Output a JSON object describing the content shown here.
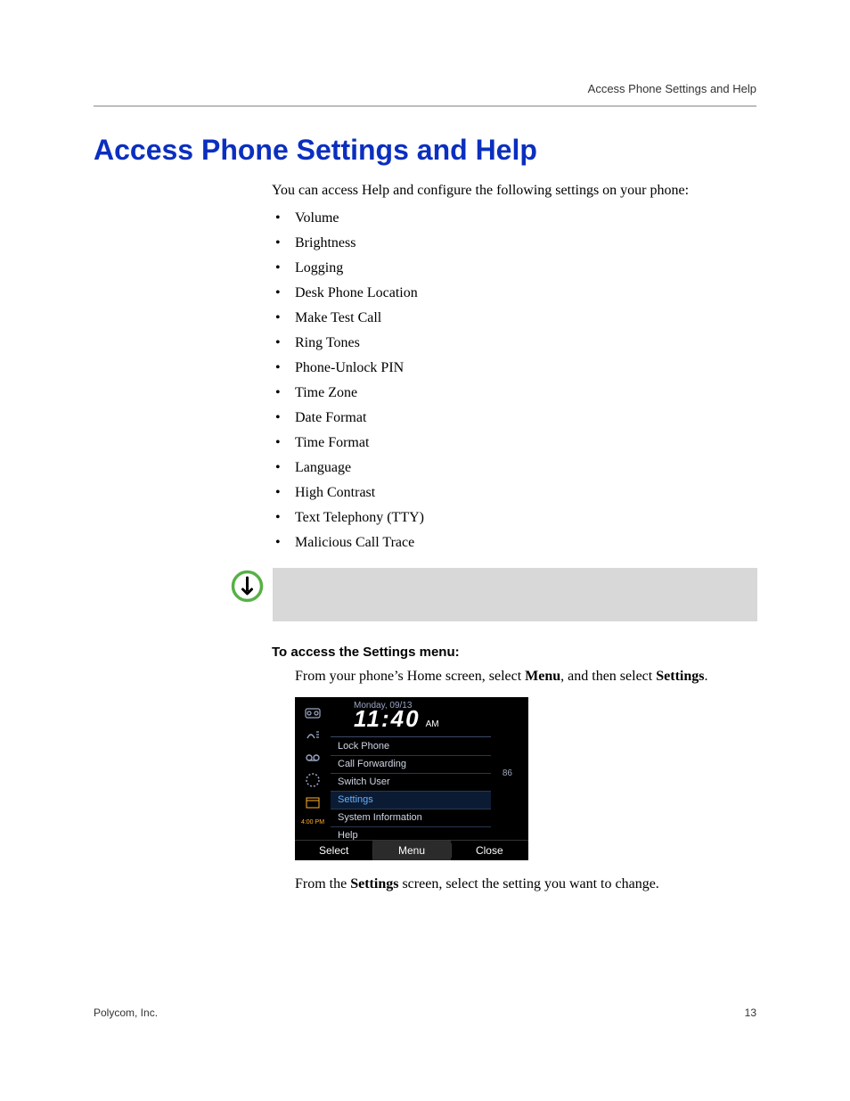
{
  "header": {
    "running_title": "Access Phone Settings and Help"
  },
  "section": {
    "title": "Access Phone Settings and Help",
    "intro": "You can access Help and configure the following settings on your phone:",
    "settings": [
      "Volume",
      "Brightness",
      "Logging",
      "Desk Phone Location",
      "Make Test Call",
      "Ring Tones",
      "Phone-Unlock PIN",
      "Time Zone",
      "Date Format",
      "Time Format",
      "Language",
      "High Contrast",
      "Text Telephony (TTY)",
      "Malicious Call Trace"
    ],
    "procedure_heading": "To access the Settings menu:",
    "step1_prefix": "From your phone’s Home screen, select ",
    "step1_bold1": "Menu",
    "step1_mid": ", and then select ",
    "step1_bold2": "Settings",
    "step1_suffix": ".",
    "step2_prefix": "From the ",
    "step2_bold": "Settings",
    "step2_suffix": " screen, select the setting you want to change."
  },
  "phone": {
    "date": "Monday, 09/13",
    "time": "11:40",
    "ampm": "AM",
    "sidebar_time": "4:00 PM",
    "badge": "86",
    "menu": [
      {
        "label": "Lock Phone",
        "selected": false
      },
      {
        "label": "Call Forwarding",
        "selected": false
      },
      {
        "label": "Switch User",
        "selected": false
      },
      {
        "label": "Settings",
        "selected": true
      },
      {
        "label": "System Information",
        "selected": false
      },
      {
        "label": "Help",
        "selected": false
      }
    ],
    "softkeys": {
      "left": "Select",
      "center": "Menu",
      "right": "Close"
    }
  },
  "footer": {
    "left": "Polycom, Inc.",
    "page": "13"
  }
}
